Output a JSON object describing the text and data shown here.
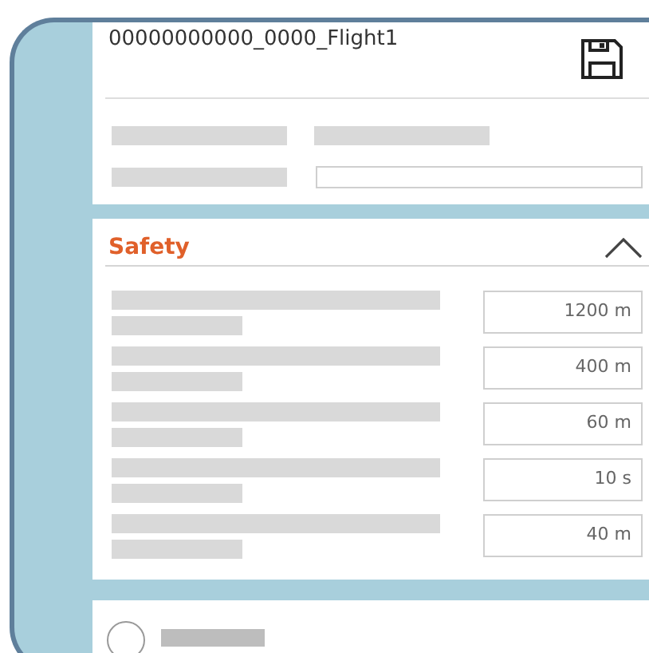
{
  "header": {
    "title": "00000000000_0000_Flight1"
  },
  "safety": {
    "title": "Safety",
    "expanded": true,
    "fields": [
      {
        "value": "1200 m"
      },
      {
        "value": "400 m"
      },
      {
        "value": "60 m"
      },
      {
        "value": "10 s"
      },
      {
        "value": "40 m"
      }
    ]
  },
  "next_item": {
    "selected": false
  }
}
